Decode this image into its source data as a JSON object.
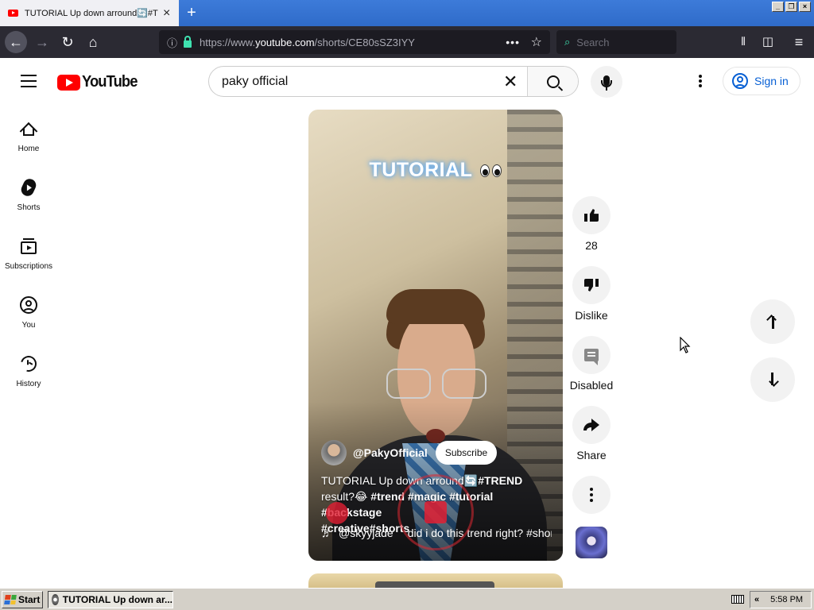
{
  "browser": {
    "tab_title": "TUTORIAL Up down arround🔄#TREND",
    "url_prefix": "https://www.",
    "url_domain": "youtube.com",
    "url_path": "/shorts/CE80sSZ3IYY",
    "search_placeholder": "Search",
    "icons": [
      "back-icon",
      "forward-icon",
      "reload-icon",
      "home-icon",
      "info-icon",
      "lock-icon",
      "page-actions-icon",
      "bookmark-star-icon",
      "library-icon",
      "sidebar-icon",
      "menu-icon"
    ]
  },
  "header": {
    "logo_text": "YouTube",
    "search_value": "paky official",
    "signin_label": "Sign in"
  },
  "guide": {
    "items": [
      {
        "label": "Home",
        "icon": "home-icon"
      },
      {
        "label": "Shorts",
        "icon": "shorts-icon"
      },
      {
        "label": "Subscriptions",
        "icon": "subscriptions-icon"
      },
      {
        "label": "You",
        "icon": "you-icon"
      },
      {
        "label": "History",
        "icon": "history-icon"
      }
    ]
  },
  "short": {
    "overlay_title": "TUTORIAL",
    "channel_handle": "@PakyOfficial",
    "subscribe_label": "Subscribe",
    "caption_plain_1": "TUTORIAL Up down arround🔄",
    "caption_tag_trend": "#TREND",
    "caption_plain_2": "result?😂 ",
    "caption_hashtags_1": "#trend #magic #tutorial #backstage",
    "caption_hashtags_2": "#creative#shorts",
    "music_creator": "@skyyjade",
    "music_title": "did i do this trend right? #shor"
  },
  "actions": {
    "like_count": "28",
    "dislike_label": "Dislike",
    "comments_label": "Disabled",
    "share_label": "Share"
  },
  "taskbar": {
    "start_label": "Start",
    "task_label": "TUTORIAL Up down ar...",
    "clock": "5:58 PM"
  },
  "colors": {
    "youtube_red": "#ff0000",
    "signin_blue": "#065fd4",
    "browser_toolbar": "#2b2a33",
    "titlebar_blue": "#3d7bd9"
  }
}
